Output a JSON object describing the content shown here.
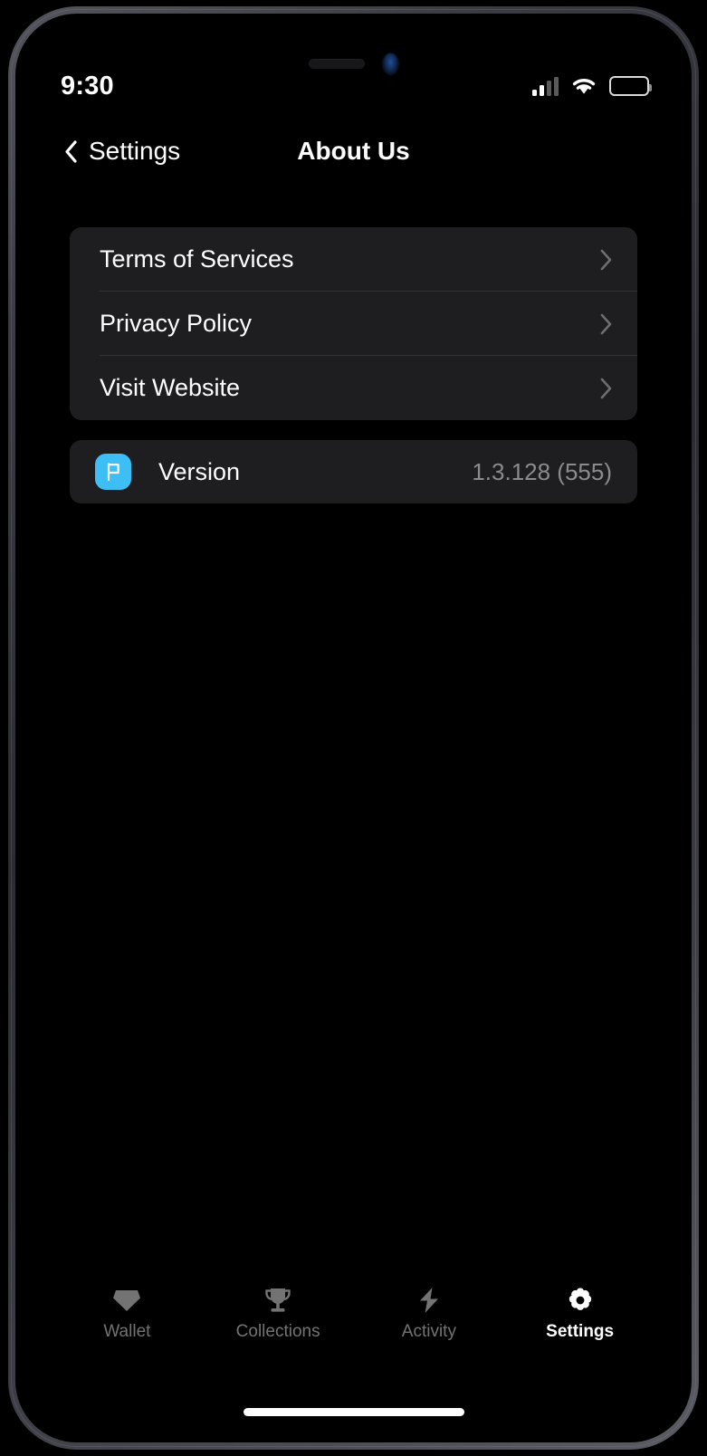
{
  "status_bar": {
    "time": "9:30",
    "icons": {
      "signal": "cellular-signal-icon",
      "wifi": "wifi-icon",
      "battery": "battery-icon"
    }
  },
  "nav": {
    "back_icon": "chevron-left-icon",
    "back_label": "Settings",
    "title": "About Us"
  },
  "links_card": {
    "rows": [
      {
        "label": "Terms of Services",
        "accessory_icon": "chevron-right-icon"
      },
      {
        "label": "Privacy Policy",
        "accessory_icon": "chevron-right-icon"
      },
      {
        "label": "Visit Website",
        "accessory_icon": "chevron-right-icon"
      }
    ]
  },
  "version_card": {
    "app_icon": "flag-icon",
    "app_icon_color": "#3dbef5",
    "label": "Version",
    "value": "1.3.128 (555)"
  },
  "tab_bar": {
    "items": [
      {
        "label": "Wallet",
        "icon": "gem-icon",
        "active": false
      },
      {
        "label": "Collections",
        "icon": "trophy-icon",
        "active": false
      },
      {
        "label": "Activity",
        "icon": "lightning-bolt-icon",
        "active": false
      },
      {
        "label": "Settings",
        "icon": "gear-icon",
        "active": true
      }
    ]
  },
  "theme": {
    "background": "#000000",
    "card_background": "#1e1e20",
    "separator": "#333336",
    "primary_text": "#ffffff",
    "secondary_text": "#8b8b8f",
    "accent": "#3dbef5"
  }
}
